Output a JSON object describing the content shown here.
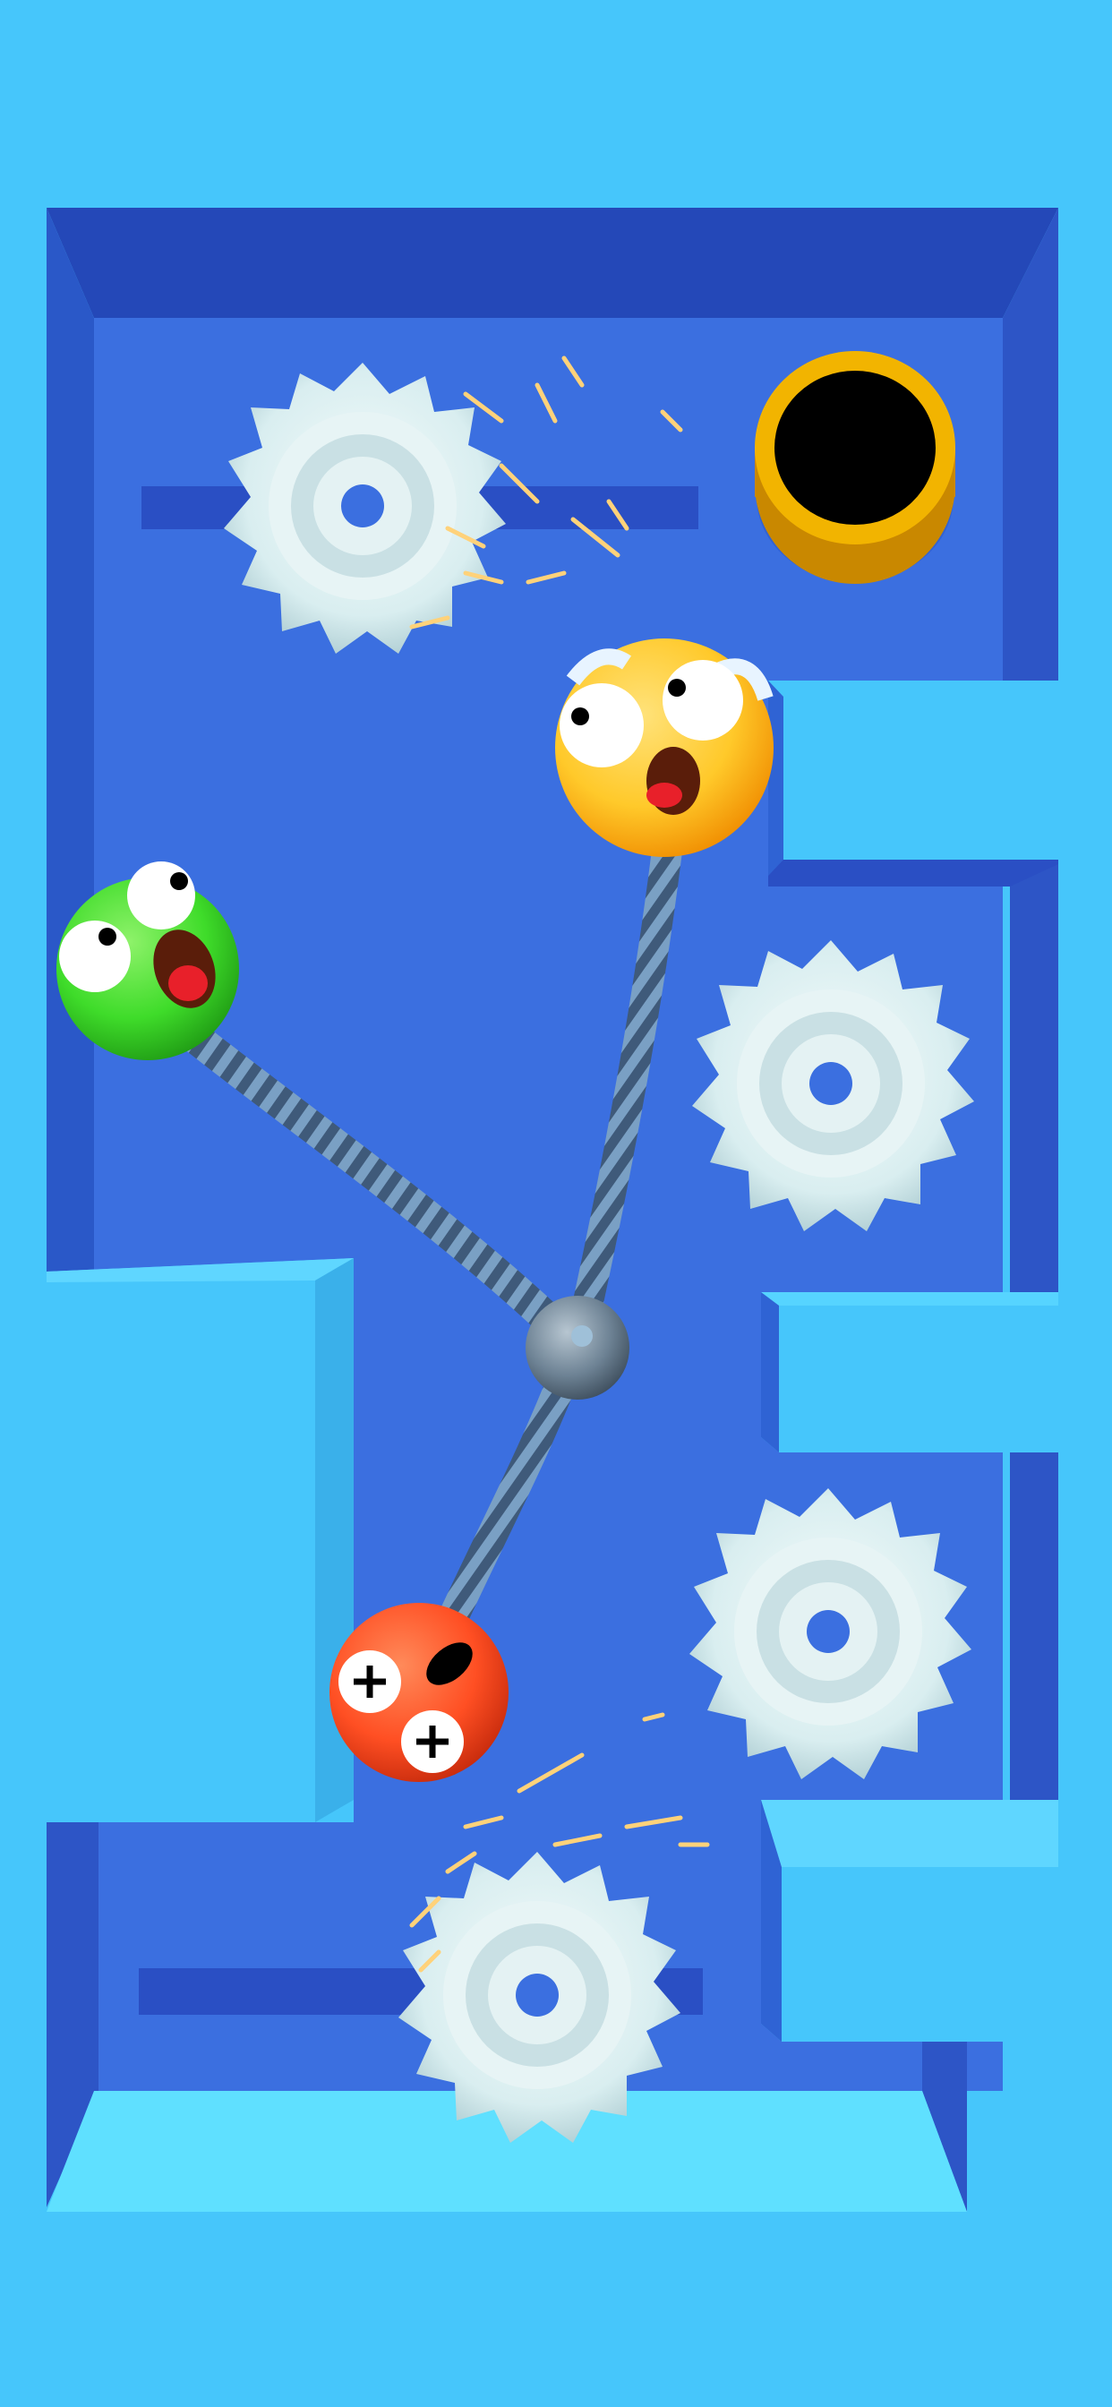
{
  "game": {
    "genre": "rope-cut puzzle",
    "hud": [],
    "palette": {
      "sky": "#46c6fb",
      "floor": "#3b6fe0",
      "wall_dark": "#2a4fc4",
      "wall_light": "#5fd6ff",
      "goal_rim": "#f2b400",
      "goal_hole": "#000000",
      "saw_blade": "#d9eef0",
      "spark": "#ffd27a",
      "rope": "#4f6d8f",
      "hub": "#6d8294"
    }
  },
  "objects": {
    "goal_hole": {
      "kind": "hole-icon",
      "color": "#f2b400"
    },
    "saws": [
      {
        "id": "saw-top-left",
        "kind": "saw-blade-icon",
        "sparking": true
      },
      {
        "id": "saw-right-middle",
        "kind": "saw-blade-icon",
        "sparking": false
      },
      {
        "id": "saw-right-lower",
        "kind": "saw-blade-icon",
        "sparking": false
      },
      {
        "id": "saw-bottom",
        "kind": "saw-blade-icon",
        "sparking": true
      }
    ],
    "balls": [
      {
        "id": "ball-yellow",
        "kind": "scared-face-icon",
        "color": "#ffc92a"
      },
      {
        "id": "ball-green",
        "kind": "screaming-face-icon",
        "color": "#3fdc2a"
      },
      {
        "id": "ball-red",
        "kind": "plus-eyes-face-icon",
        "color": "#ff4f23"
      }
    ],
    "ropes": [
      {
        "id": "rope-yellow",
        "connects": "ball-yellow"
      },
      {
        "id": "rope-green",
        "connects": "ball-green"
      },
      {
        "id": "rope-red",
        "connects": "ball-red"
      }
    ],
    "hub": {
      "kind": "rope-knot-icon"
    }
  }
}
